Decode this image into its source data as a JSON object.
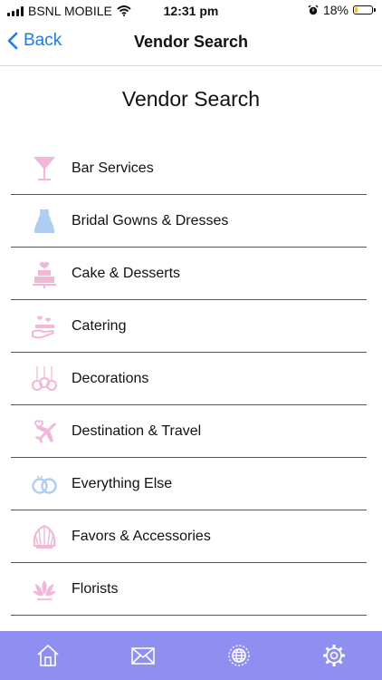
{
  "status": {
    "carrier": "BSNL MOBILE",
    "time": "12:31 pm",
    "battery_percent": 18,
    "battery_label": "18%"
  },
  "nav": {
    "back_label": "Back",
    "title": "Vendor Search"
  },
  "page": {
    "title": "Vendor Search"
  },
  "vendors": [
    {
      "label": "Bar Services",
      "icon": "cocktail-glass-icon"
    },
    {
      "label": "Bridal Gowns & Dresses",
      "icon": "dress-icon"
    },
    {
      "label": "Cake & Desserts",
      "icon": "cake-icon"
    },
    {
      "label": "Catering",
      "icon": "catering-icon"
    },
    {
      "label": "Decorations",
      "icon": "hanging-ornaments-icon"
    },
    {
      "label": "Destination & Travel",
      "icon": "airplane-heart-icon"
    },
    {
      "label": "Everything Else",
      "icon": "rings-icon"
    },
    {
      "label": "Favors & Accessories",
      "icon": "shell-icon"
    },
    {
      "label": "Florists",
      "icon": "lotus-icon"
    }
  ],
  "tabs": [
    {
      "icon": "home-icon"
    },
    {
      "icon": "mail-icon"
    },
    {
      "icon": "globe-icon"
    },
    {
      "icon": "settings-gear-icon"
    }
  ],
  "colors": {
    "accent": "#1a7cf5",
    "tab_bar": "#8f8ff2",
    "icon_pink": "#f3b6d8",
    "icon_blue": "#aecdf2",
    "battery": "#f4c430"
  }
}
